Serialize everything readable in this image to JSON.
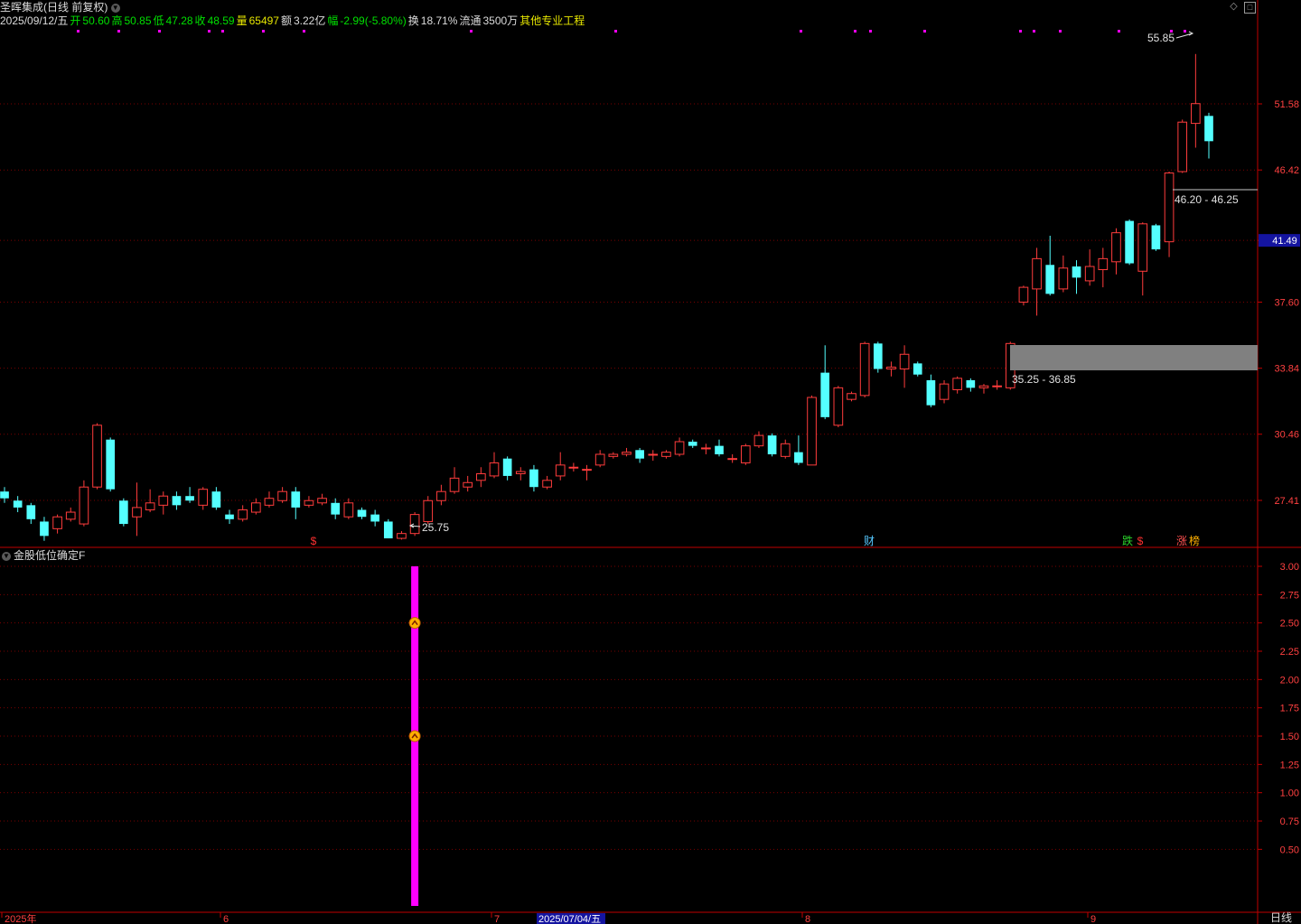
{
  "header": {
    "stock_name": "圣晖集成",
    "chart_mode": "(日线 前复权)",
    "date": "2025/09/12/五",
    "open_label": "开",
    "open": "50.60",
    "high_label": "高",
    "high": "50.85",
    "low_label": "低",
    "low": "47.28",
    "close_label": "收",
    "close": "48.59",
    "volume_label": "量",
    "volume": "65497",
    "amount_label": "额",
    "amount": "3.22亿",
    "change_label": "幅",
    "change": "-2.99(-5.80%)",
    "turnover_label": "换",
    "turnover": "18.71%",
    "float_label": "流通",
    "float": "3500万",
    "sector": "其他专业工程"
  },
  "price_axis": {
    "ticks": [
      "51.58",
      "46.42",
      "41.49",
      "37.60",
      "33.84",
      "30.46",
      "27.41"
    ],
    "current_price": "41.49"
  },
  "annotations": {
    "high_mark": "55.85",
    "low_mark": "25.75",
    "zone_upper": "46.20 - 46.25",
    "zone_lower": "35.25 - 36.85"
  },
  "event_badges": [
    "$",
    "财",
    "跌",
    "$",
    "涨",
    "榜"
  ],
  "indicator": {
    "title": "金股低位确定F",
    "axis_ticks": [
      "3.00",
      "2.75",
      "2.50",
      "2.25",
      "2.00",
      "1.75",
      "1.50",
      "1.25",
      "1.00",
      "0.75",
      "0.50"
    ]
  },
  "time_axis": {
    "labels": [
      "2025年",
      "6",
      "7",
      "2025/07/04/五",
      "8",
      "9"
    ],
    "period": "日线"
  },
  "colors": {
    "up": "#ff3c3c",
    "down": "#54ffff",
    "grid": "#7a0000",
    "axis": "#c00000",
    "signal": "#ff00ff",
    "zone": "#808080",
    "marker": "#ff00ff"
  },
  "chart_data": {
    "type": "candlestick",
    "x_range": [
      "2025-05",
      "2025-09-12"
    ],
    "y_range": [
      24.0,
      57.0
    ],
    "candles": [
      [
        27.8,
        27.5,
        28.0,
        27.3
      ],
      [
        27.4,
        27.1,
        27.6,
        26.9
      ],
      [
        27.2,
        26.6,
        27.3,
        26.4
      ],
      [
        26.5,
        25.9,
        26.7,
        25.7
      ],
      [
        26.2,
        26.7,
        26.8,
        26.0
      ],
      [
        26.6,
        26.9,
        27.1,
        26.5
      ],
      [
        26.4,
        28.0,
        28.3,
        26.3
      ],
      [
        28.0,
        30.9,
        31.0,
        27.9
      ],
      [
        30.2,
        27.9,
        30.3,
        27.8
      ],
      [
        27.4,
        26.4,
        27.5,
        26.3
      ],
      [
        26.7,
        27.1,
        28.2,
        25.9
      ],
      [
        27.0,
        27.3,
        27.9,
        26.9
      ],
      [
        27.2,
        27.6,
        27.8,
        26.8
      ],
      [
        27.6,
        27.2,
        27.8,
        27.0
      ],
      [
        27.6,
        27.4,
        28.0,
        27.3
      ],
      [
        27.2,
        27.9,
        28.0,
        27.0
      ],
      [
        27.8,
        27.1,
        28.0,
        27.0
      ],
      [
        26.8,
        26.6,
        27.0,
        26.4
      ],
      [
        26.6,
        27.0,
        27.2,
        26.5
      ],
      [
        26.9,
        27.3,
        27.5,
        26.8
      ],
      [
        27.2,
        27.5,
        27.8,
        27.1
      ],
      [
        27.4,
        27.8,
        28.0,
        27.3
      ],
      [
        27.8,
        27.1,
        28.0,
        26.6
      ],
      [
        27.2,
        27.4,
        27.6,
        27.1
      ],
      [
        27.3,
        27.5,
        27.7,
        27.2
      ],
      [
        27.3,
        26.8,
        27.5,
        26.6
      ],
      [
        26.7,
        27.3,
        27.5,
        26.6
      ],
      [
        27.0,
        26.7,
        27.1,
        26.6
      ],
      [
        26.8,
        26.5,
        27.0,
        26.3
      ],
      [
        26.5,
        25.8,
        26.6,
        25.8
      ],
      [
        25.8,
        26.0,
        26.1,
        25.75
      ],
      [
        26.0,
        26.8,
        26.9,
        25.9
      ],
      [
        26.5,
        27.4,
        27.6,
        26.4
      ],
      [
        27.4,
        27.8,
        28.1,
        27.2
      ],
      [
        27.8,
        28.4,
        28.9,
        27.7
      ],
      [
        28.0,
        28.2,
        28.5,
        27.8
      ],
      [
        28.3,
        28.6,
        28.9,
        28.0
      ],
      [
        28.5,
        29.1,
        29.6,
        28.4
      ],
      [
        29.3,
        28.5,
        29.4,
        28.3
      ],
      [
        28.6,
        28.7,
        28.9,
        28.3
      ],
      [
        28.8,
        28.0,
        29.0,
        27.8
      ],
      [
        28.0,
        28.3,
        28.5,
        27.9
      ],
      [
        28.5,
        29.0,
        29.6,
        28.3
      ],
      [
        28.9,
        28.9,
        29.1,
        28.7
      ],
      [
        28.8,
        28.8,
        29.0,
        28.3
      ],
      [
        29.0,
        29.5,
        29.7,
        28.9
      ],
      [
        29.4,
        29.5,
        29.6,
        29.3
      ],
      [
        29.5,
        29.6,
        29.8,
        29.4
      ],
      [
        29.7,
        29.3,
        29.8,
        29.1
      ],
      [
        29.5,
        29.5,
        29.7,
        29.2
      ],
      [
        29.4,
        29.6,
        29.7,
        29.3
      ],
      [
        29.5,
        30.1,
        30.3,
        29.4
      ],
      [
        30.1,
        29.9,
        30.2,
        29.8
      ],
      [
        29.8,
        29.8,
        30.0,
        29.5
      ],
      [
        29.9,
        29.5,
        30.2,
        29.4
      ],
      [
        29.3,
        29.3,
        29.5,
        29.1
      ],
      [
        29.1,
        29.9,
        30.0,
        29.0
      ],
      [
        29.9,
        30.4,
        30.6,
        29.8
      ],
      [
        30.4,
        29.5,
        30.5,
        29.4
      ],
      [
        29.4,
        30.0,
        30.2,
        29.3
      ],
      [
        29.6,
        29.1,
        30.4,
        29.0
      ],
      [
        29.0,
        32.3,
        32.4,
        29.0
      ],
      [
        33.6,
        31.3,
        35.1,
        31.2
      ],
      [
        30.9,
        32.8,
        32.9,
        30.8
      ],
      [
        32.2,
        32.5,
        32.6,
        32.1
      ],
      [
        32.4,
        35.2,
        35.3,
        32.3
      ],
      [
        35.2,
        33.8,
        35.3,
        33.6
      ],
      [
        33.8,
        33.9,
        34.2,
        33.4
      ],
      [
        33.8,
        34.6,
        35.1,
        32.8
      ],
      [
        34.1,
        33.5,
        34.2,
        33.4
      ],
      [
        33.2,
        31.9,
        33.5,
        31.8
      ],
      [
        32.2,
        33.0,
        33.2,
        32.0
      ],
      [
        32.7,
        33.3,
        33.4,
        32.5
      ],
      [
        33.2,
        32.8,
        33.3,
        32.6
      ],
      [
        32.8,
        32.9,
        33.0,
        32.5
      ],
      [
        32.9,
        32.9,
        33.2,
        32.7
      ],
      [
        32.8,
        35.2,
        35.3,
        32.7
      ],
      [
        37.6,
        38.5,
        38.6,
        37.4
      ],
      [
        38.4,
        40.3,
        41.0,
        36.8
      ],
      [
        39.9,
        38.1,
        41.8,
        38.0
      ],
      [
        38.4,
        39.7,
        40.5,
        38.2
      ],
      [
        39.8,
        39.1,
        40.2,
        38.1
      ],
      [
        38.9,
        39.8,
        40.9,
        38.6
      ],
      [
        39.6,
        40.3,
        41.0,
        38.5
      ],
      [
        40.1,
        42.0,
        42.3,
        39.3
      ],
      [
        42.8,
        40.0,
        42.9,
        39.9
      ],
      [
        39.5,
        42.6,
        42.7,
        38.0
      ],
      [
        42.5,
        40.9,
        42.6,
        40.8
      ],
      [
        41.4,
        46.2,
        46.3,
        40.4
      ],
      [
        46.3,
        50.1,
        50.3,
        46.2
      ],
      [
        50.0,
        51.6,
        55.85,
        48.1
      ],
      [
        50.6,
        48.6,
        50.85,
        47.28
      ]
    ],
    "indicator_signal": {
      "category_index": 31,
      "value": 3.0,
      "markers": [
        2.5,
        1.5
      ]
    },
    "indicator_y_range": [
      0.0,
      3.0
    ]
  }
}
